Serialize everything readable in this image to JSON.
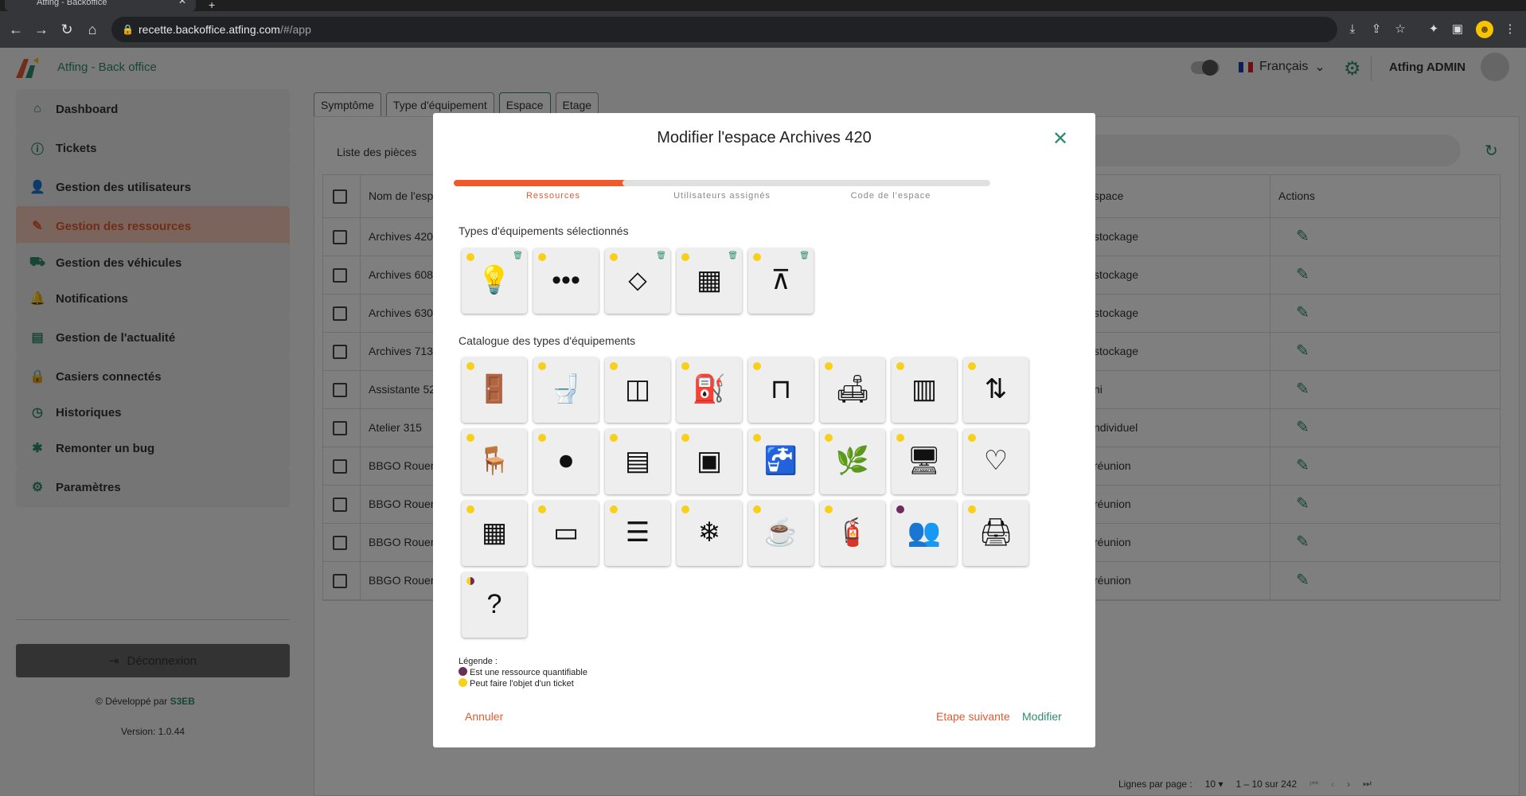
{
  "browser": {
    "tab_title": "Atfing - Backoffice",
    "url_host": "recette.backoffice.atfing.com",
    "url_path": "/#/app"
  },
  "header": {
    "title": "Atfing - Back office",
    "language": "Français",
    "user": "Atfing ADMIN"
  },
  "sidebar": {
    "items": [
      {
        "label": "Dashboard",
        "icon": "home-icon"
      },
      {
        "label": "Tickets",
        "icon": "info-icon"
      },
      {
        "label": "Gestion des utilisateurs",
        "icon": "user-icon"
      },
      {
        "label": "Gestion des ressources",
        "icon": "pencil-icon"
      },
      {
        "label": "Gestion des véhicules",
        "icon": "truck-icon"
      },
      {
        "label": "Notifications",
        "icon": "bell-icon"
      },
      {
        "label": "Gestion de l'actualité",
        "icon": "news-icon"
      },
      {
        "label": "Casiers connectés",
        "icon": "lock-icon"
      },
      {
        "label": "Historiques",
        "icon": "clock-icon"
      },
      {
        "label": "Remonter un bug",
        "icon": "bug-icon"
      },
      {
        "label": "Paramètres",
        "icon": "gear-icon"
      }
    ],
    "active_index": 3,
    "logout": "Déconnexion",
    "developed_by": "Développé par",
    "developer": "S3EB",
    "version": "Version: 1.0.44"
  },
  "main": {
    "tabs": [
      "Symptôme",
      "Type d'équipement",
      "Espace",
      "Etage"
    ],
    "active_tab": "Espace",
    "panel_title": "Liste des pièces",
    "table": {
      "headers": {
        "name": "Nom de l'esp",
        "type": "space",
        "actions": "Actions"
      },
      "rows": [
        {
          "name": "Archives 420",
          "type": "stockage"
        },
        {
          "name": "Archives 608",
          "type": "stockage"
        },
        {
          "name": "Archives 630",
          "type": "stockage"
        },
        {
          "name": "Archives 713",
          "type": "stockage"
        },
        {
          "name": "Assistante 52",
          "type": "ni"
        },
        {
          "name": "Atelier 315",
          "type": "ndividuel"
        },
        {
          "name": "BBGO Rouen-",
          "type": "réunion"
        },
        {
          "name": "BBGO Rouen-",
          "type": "réunion"
        },
        {
          "name": "BBGO Rouen-",
          "type": "réunion"
        },
        {
          "name": "BBGO Rouen-",
          "type": "réunion"
        }
      ]
    },
    "pager": {
      "label": "Lignes par page :",
      "per_page": "10",
      "range": "1 – 10 sur 242"
    }
  },
  "modal": {
    "title": "Modifier l'espace Archives 420",
    "steps": [
      "Ressources",
      "Utilisateurs assignés",
      "Code de l'espace"
    ],
    "active_step": 0,
    "selected_title": "Types d'équipements sélectionnés",
    "selected": [
      {
        "icon": "lightbulb-icon",
        "glyph": "💡",
        "dot": "yellow",
        "removable": true
      },
      {
        "icon": "more-icon",
        "glyph": "•••",
        "dot": "yellow",
        "removable": false
      },
      {
        "icon": "floor-icon",
        "glyph": "⬦",
        "dot": "yellow",
        "removable": true
      },
      {
        "icon": "wall-icon",
        "glyph": "▦",
        "dot": "yellow",
        "removable": true
      },
      {
        "icon": "ceiling-icon",
        "glyph": "⊼",
        "dot": "yellow",
        "removable": true
      }
    ],
    "catalog_title": "Catalogue des types d'équipements",
    "catalog": [
      {
        "icon": "door-icon",
        "glyph": "🚪",
        "dot": "yellow"
      },
      {
        "icon": "toilet-icon",
        "glyph": "🚽",
        "dot": "yellow"
      },
      {
        "icon": "wardrobe-icon",
        "glyph": "◫",
        "dot": "yellow"
      },
      {
        "icon": "water-dispenser-icon",
        "glyph": "⛽",
        "dot": "yellow"
      },
      {
        "icon": "table-icon",
        "glyph": "⊓",
        "dot": "yellow"
      },
      {
        "icon": "sofa-icon",
        "glyph": "🛋",
        "dot": "yellow"
      },
      {
        "icon": "window-icon",
        "glyph": "▥",
        "dot": "yellow"
      },
      {
        "icon": "elevator-icon",
        "glyph": "⇅",
        "dot": "yellow"
      },
      {
        "icon": "chair-icon",
        "glyph": "🪑",
        "dot": "yellow"
      },
      {
        "icon": "power-outlet-icon",
        "glyph": "⏺",
        "dot": "yellow"
      },
      {
        "icon": "fridge-icon",
        "glyph": "▤",
        "dot": "yellow"
      },
      {
        "icon": "oven-icon",
        "glyph": "▣",
        "dot": "yellow"
      },
      {
        "icon": "sink-icon",
        "glyph": "🚰",
        "dot": "yellow"
      },
      {
        "icon": "plant-care-icon",
        "glyph": "🌿",
        "dot": "yellow"
      },
      {
        "icon": "screen-icon",
        "glyph": "🖥",
        "dot": "yellow"
      },
      {
        "icon": "defibrillator-icon",
        "glyph": "♡",
        "dot": "yellow"
      },
      {
        "icon": "vending-machine-icon",
        "glyph": "▦",
        "dot": "yellow"
      },
      {
        "icon": "badge-reader-icon",
        "glyph": "▭",
        "dot": "yellow"
      },
      {
        "icon": "blinds-icon",
        "glyph": "☰",
        "dot": "yellow"
      },
      {
        "icon": "air-conditioner-icon",
        "glyph": "❄",
        "dot": "yellow"
      },
      {
        "icon": "coffee-machine-icon",
        "glyph": "☕",
        "dot": "yellow"
      },
      {
        "icon": "fire-extinguisher-icon",
        "glyph": "🧯",
        "dot": "yellow"
      },
      {
        "icon": "meeting-icon",
        "glyph": "👥",
        "dot": "purple"
      },
      {
        "icon": "printer-icon",
        "glyph": "🖨",
        "dot": "yellow"
      },
      {
        "icon": "question-icon",
        "glyph": "?",
        "dot": "half"
      }
    ],
    "legend": {
      "title": "Légende :",
      "quantifiable": "Est une ressource quantifiable",
      "ticket": "Peut faire l'objet d'un ticket"
    },
    "buttons": {
      "cancel": "Annuler",
      "next": "Etape suivante",
      "save": "Modifier"
    }
  },
  "colors": {
    "accent": "#2e8b6f",
    "orange": "#e35a2f",
    "dot_yellow": "#f6d01b",
    "dot_purple": "#6b2e5a"
  }
}
